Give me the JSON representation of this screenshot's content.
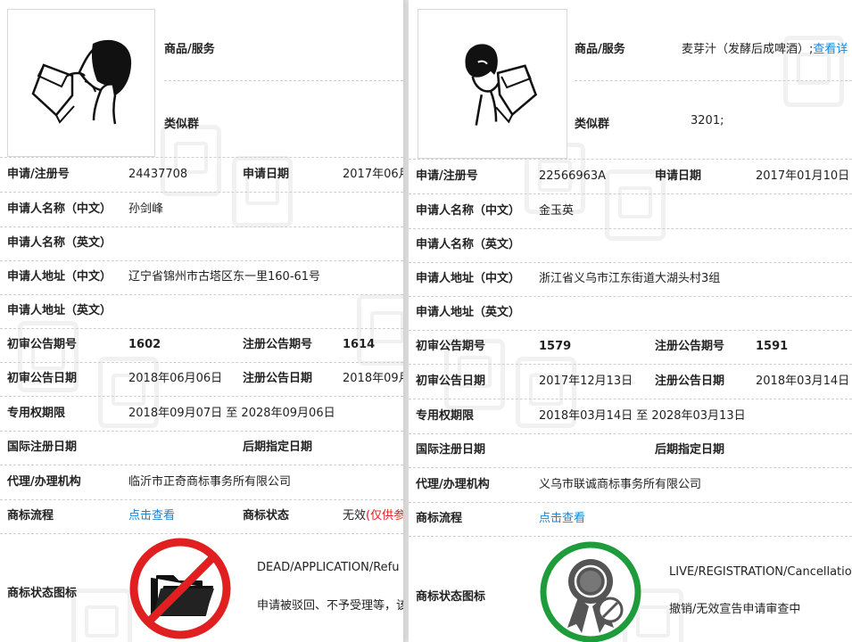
{
  "left": {
    "goods_services_label": "商品/服务",
    "goods_services_value": "",
    "similar_group_label": "类似群",
    "similar_group_value": "",
    "rows": [
      {
        "l1": "申请/注册号",
        "v1": "24437708",
        "l2": "申请日期",
        "v2": "2017年06月"
      },
      {
        "l1": "申请人名称（中文）",
        "v1": "孙剑峰"
      },
      {
        "l1": "申请人名称（英文）",
        "v1": ""
      },
      {
        "l1": "申请人地址（中文）",
        "v1": "辽宁省锦州市古塔区东一里160-61号"
      },
      {
        "l1": "申请人地址（英文）",
        "v1": ""
      },
      {
        "l1": "初审公告期号",
        "v1": "1602",
        "l2": "注册公告期号",
        "v2": "1614"
      },
      {
        "l1": "初审公告日期",
        "v1": "2018年06月06日",
        "l2": "注册公告日期",
        "v2": "2018年09月"
      },
      {
        "l1": "专用权期限",
        "v1": "2018年09月07日 至 2028年09月06日"
      },
      {
        "l1": "国际注册日期",
        "v1": "",
        "l2": "后期指定日期",
        "v2": ""
      },
      {
        "l1": "代理/办理机构",
        "v1": "临沂市正奇商标事务所有限公司"
      },
      {
        "l1": "商标流程",
        "v1": "点击查看",
        "l2": "商标状态",
        "v2": "无效",
        "v2_extra": "(仅供参"
      }
    ],
    "status_icon_label": "商标状态图标",
    "status_icon": "dead-folder-icon",
    "status_code": "DEAD/APPLICATION/Refu",
    "status_desc": "申请被驳回、不予受理等，该"
  },
  "right": {
    "goods_services_label": "商品/服务",
    "goods_services_value": "麦芽汁（发酵后成啤酒）;",
    "goods_services_link": "查看详",
    "similar_group_label": "类似群",
    "similar_group_value": "3201;",
    "rows": [
      {
        "l1": "申请/注册号",
        "v1": "22566963A",
        "l2": "申请日期",
        "v2": "2017年01月10日"
      },
      {
        "l1": "申请人名称（中文）",
        "v1": "金玉英"
      },
      {
        "l1": "申请人名称（英文）",
        "v1": ""
      },
      {
        "l1": "申请人地址（中文）",
        "v1": "浙江省义乌市江东街道大湖头村3组"
      },
      {
        "l1": "申请人地址（英文）",
        "v1": ""
      },
      {
        "l1": "初审公告期号",
        "v1": "1579",
        "l2": "注册公告期号",
        "v2": "1591"
      },
      {
        "l1": "初审公告日期",
        "v1": "2017年12月13日",
        "l2": "注册公告日期",
        "v2": "2018年03月14日"
      },
      {
        "l1": "专用权期限",
        "v1": "2018年03月14日 至 2028年03月13日"
      },
      {
        "l1": "国际注册日期",
        "v1": "",
        "l2": "后期指定日期",
        "v2": ""
      },
      {
        "l1": "代理/办理机构",
        "v1": "义乌市联诚商标事务所有限公司"
      },
      {
        "l1": "商标流程",
        "v1": "点击查看"
      }
    ],
    "status_icon_label": "商标状态图标",
    "status_icon": "live-ribbon-badge-icon",
    "status_code": "LIVE/REGISTRATION/Cancellatio",
    "status_desc": "撤销/无效宣告申请审查中"
  },
  "colors": {
    "link": "#1a85d6",
    "dead": "#e02020",
    "live": "#1e9b3a"
  }
}
